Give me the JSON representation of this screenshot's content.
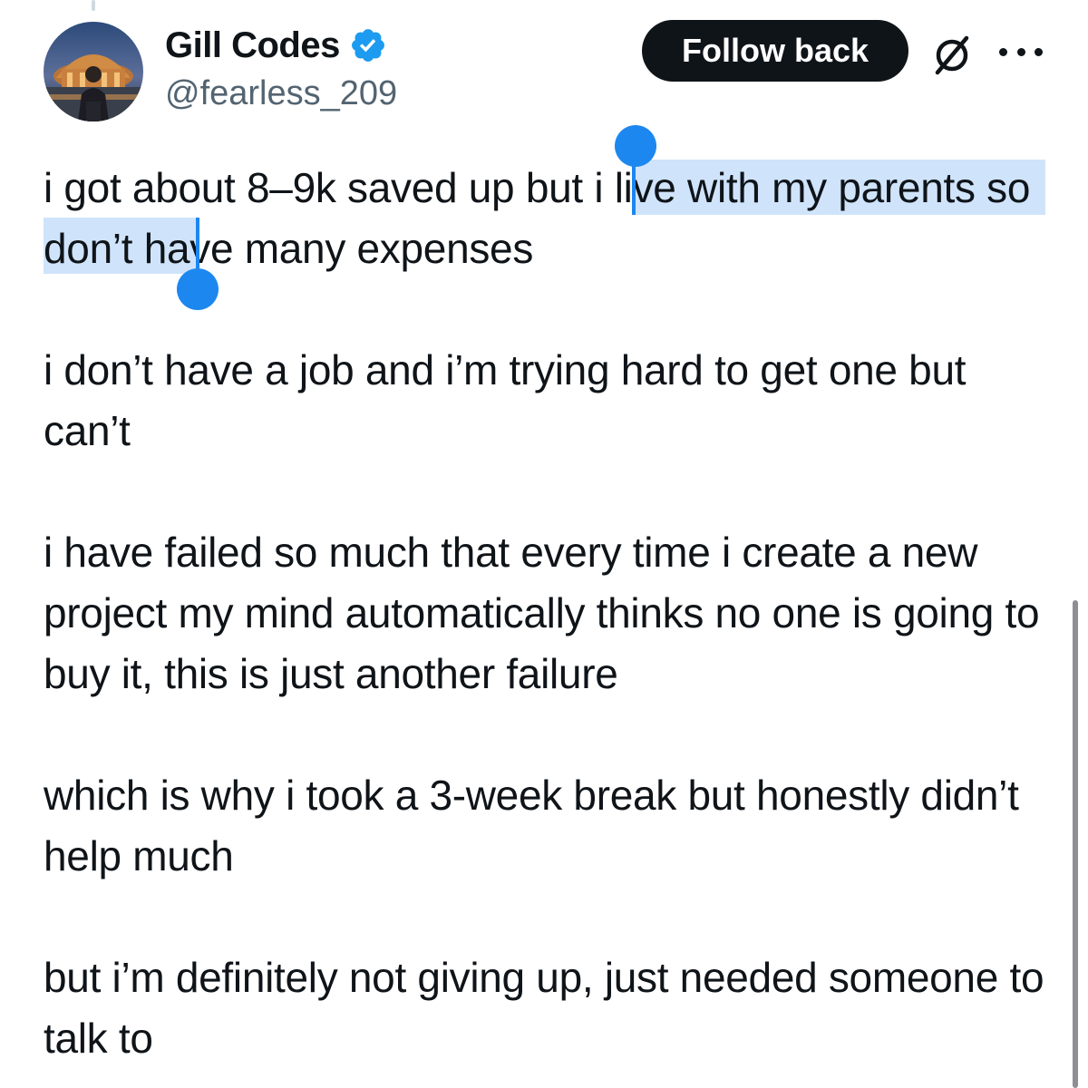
{
  "author": {
    "display_name": "Gill Codes",
    "handle": "@fearless_209",
    "verified": true,
    "verified_color": "#1d9bf0"
  },
  "actions": {
    "follow_label": "Follow back",
    "grok_icon": "slashed-circle-icon",
    "more_icon": "more-horizontal-icon"
  },
  "tweet": {
    "paragraphs": [
      {
        "before": "i got about 8–9k saved up but ",
        "selected": "i live with my parents",
        "after": " so don’t have many expenses"
      },
      {
        "text": "i don’t have a job and i’m trying hard to get one but can’t"
      },
      {
        "text": "i have failed so much that every time i create a new project my mind automatically thinks no one is going to buy it, this is just another failure"
      },
      {
        "text": "which is why i took a 3-week break but honestly didn’t help much"
      },
      {
        "text": "but i’m definitely not giving up, just needed someone to talk to"
      }
    ]
  },
  "colors": {
    "text": "#0f1419",
    "secondary": "#536471",
    "selection_highlight": "#cfe4fb",
    "selection_handle": "#1d87f0",
    "button_bg": "#0f1419"
  }
}
